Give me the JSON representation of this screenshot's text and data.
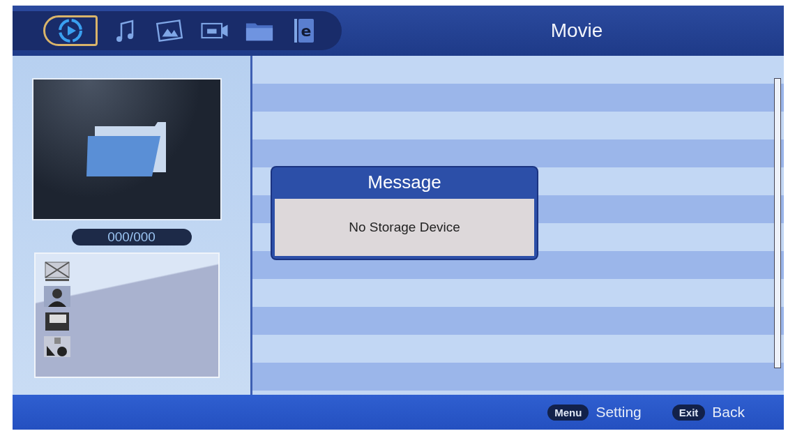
{
  "tabs": [
    {
      "kind": "movie",
      "selected": true
    },
    {
      "kind": "music",
      "selected": false
    },
    {
      "kind": "photo",
      "selected": false
    },
    {
      "kind": "video",
      "selected": false
    },
    {
      "kind": "folder",
      "selected": false
    },
    {
      "kind": "ebook",
      "selected": false,
      "glyph": "e"
    }
  ],
  "title": "Movie",
  "counter": "000/000",
  "info_icons": [
    {
      "kind": "mail"
    },
    {
      "kind": "person"
    },
    {
      "kind": "screen"
    },
    {
      "kind": "shapes"
    }
  ],
  "dialog": {
    "title": "Message",
    "text": "No Storage Device"
  },
  "hints": [
    {
      "key": "Menu",
      "label": "Setting"
    },
    {
      "key": "Exit",
      "label": "Back"
    }
  ]
}
